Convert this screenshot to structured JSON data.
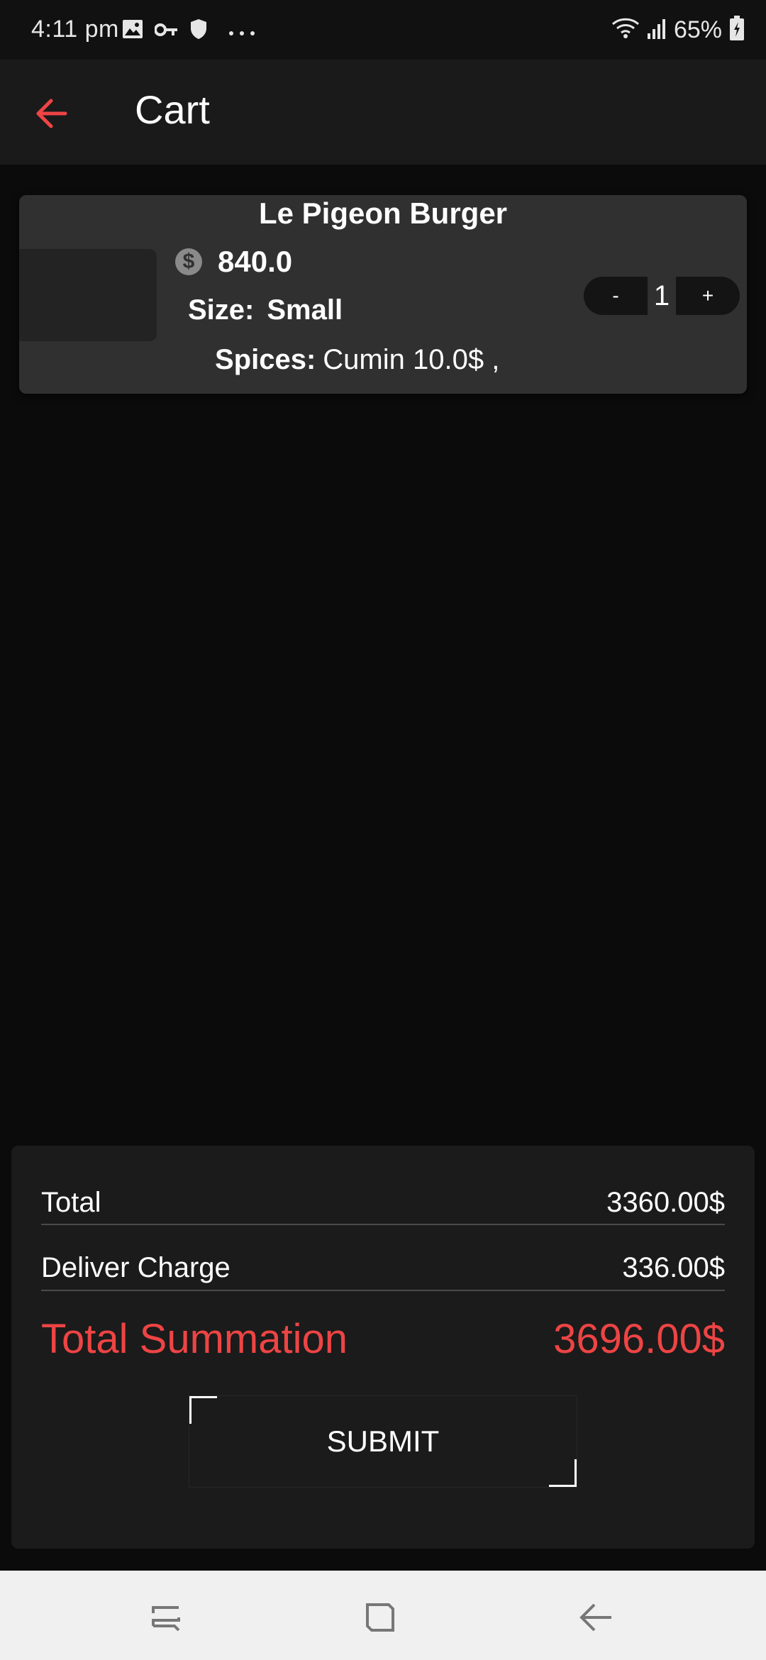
{
  "status_bar": {
    "time": "4:11 pm",
    "battery": "65%",
    "icons": [
      "image-icon",
      "key-icon",
      "shield-icon",
      "more-dots-icon",
      "wifi-icon",
      "signal-icon",
      "battery-icon"
    ]
  },
  "app_bar": {
    "title": "Cart",
    "back_icon": "arrow-left-icon"
  },
  "cart": {
    "items": [
      {
        "name": "Le Pigeon Burger",
        "price": "840.0",
        "size_label": "Size:",
        "size_value": "Small",
        "spices_label": "Spices:",
        "spices_value": "Cumin 10.0$ ,",
        "quantity": "1",
        "minus_label": "-",
        "plus_label": "+"
      }
    ]
  },
  "summary": {
    "total_label": "Total",
    "total_value": "3360.00$",
    "delivery_label": "Deliver Charge",
    "delivery_value": "336.00$",
    "summation_label": "Total Summation",
    "summation_value": "3696.00$",
    "submit_label": "SUBMIT"
  },
  "colors": {
    "accent": "#ee4444",
    "background": "#0b0b0b",
    "card": "#303030",
    "panel": "#1b1b1b",
    "app_bar": "#1a1a1a"
  },
  "nav_bar": {
    "icons": [
      "recent-apps-icon",
      "home-icon",
      "back-icon"
    ]
  }
}
